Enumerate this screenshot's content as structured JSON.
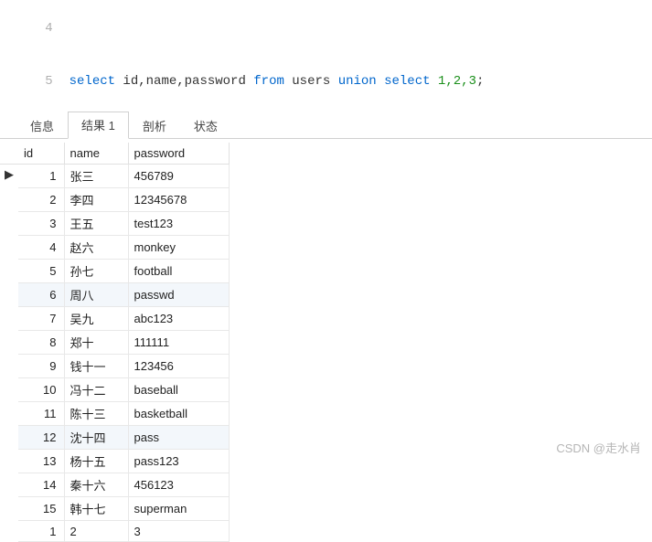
{
  "editor": {
    "prev_line_no": "4",
    "line_no": "5",
    "sql_tokens": {
      "select": "select",
      "cols": " id,name,password ",
      "from": "from",
      "tbl": " users ",
      "union": "union",
      "select2": " select",
      "vals": " 1,2,3",
      "semi": ";"
    }
  },
  "tabs": {
    "info": "信息",
    "result1": "结果 1",
    "profile": "剖析",
    "status": "状态"
  },
  "columns": {
    "id": "id",
    "name": "name",
    "password": "password"
  },
  "active_row_marker": "▶",
  "rows": [
    {
      "id": "1",
      "name": "张三",
      "password": "456789"
    },
    {
      "id": "2",
      "name": "李四",
      "password": "12345678"
    },
    {
      "id": "3",
      "name": "王五",
      "password": "test123"
    },
    {
      "id": "4",
      "name": "赵六",
      "password": "monkey"
    },
    {
      "id": "5",
      "name": "孙七",
      "password": "football"
    },
    {
      "id": "6",
      "name": "周八",
      "password": "passwd"
    },
    {
      "id": "7",
      "name": "吴九",
      "password": "abc123"
    },
    {
      "id": "8",
      "name": "郑十",
      "password": "111111"
    },
    {
      "id": "9",
      "name": "钱十一",
      "password": "123456"
    },
    {
      "id": "10",
      "name": "冯十二",
      "password": "baseball"
    },
    {
      "id": "11",
      "name": "陈十三",
      "password": "basketball"
    },
    {
      "id": "12",
      "name": "沈十四",
      "password": "pass"
    },
    {
      "id": "13",
      "name": "杨十五",
      "password": "pass123"
    },
    {
      "id": "14",
      "name": "秦十六",
      "password": "456123"
    },
    {
      "id": "15",
      "name": "韩十七",
      "password": "superman"
    },
    {
      "id": "1",
      "name": "2",
      "password": "3"
    }
  ],
  "watermark": "CSDN @走水肖"
}
